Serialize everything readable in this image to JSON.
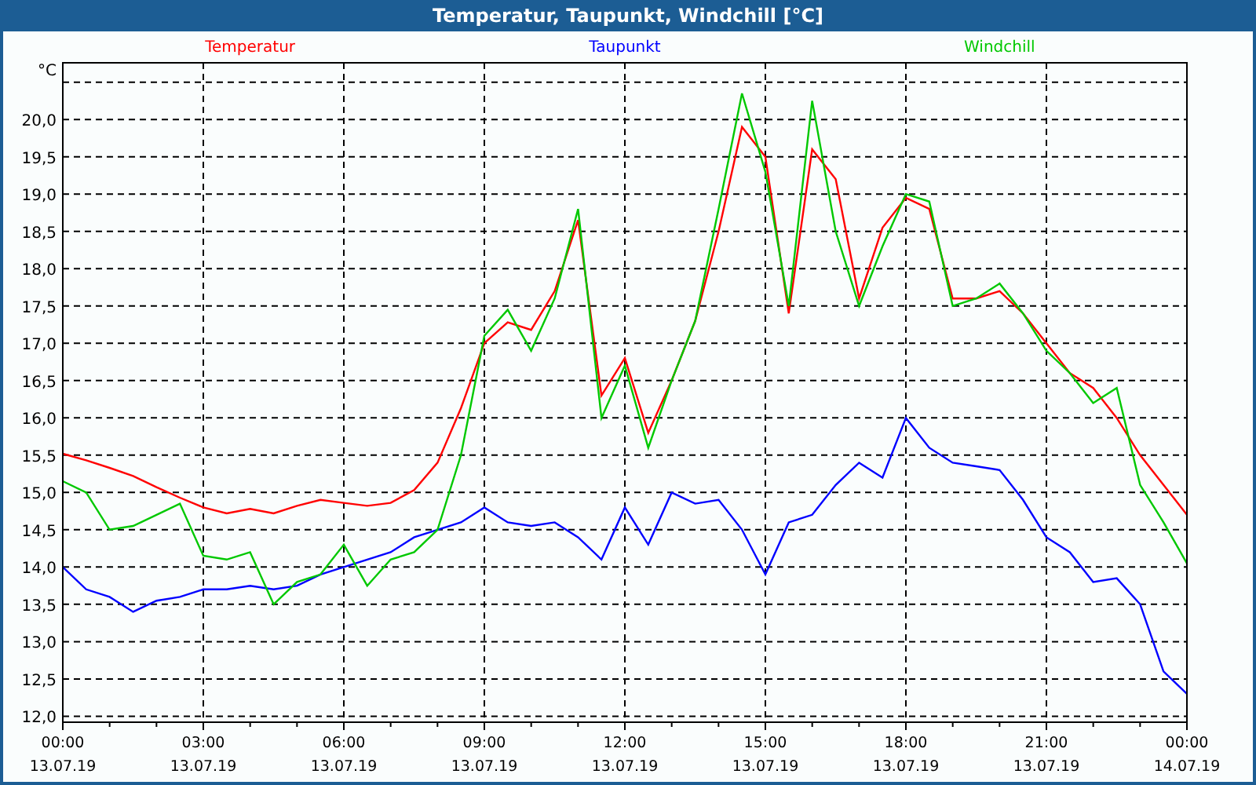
{
  "window": {
    "title": "Temperatur, Taupunkt, Windchill [°C]"
  },
  "chart": {
    "chart_data": {
      "type": "line",
      "grid": true,
      "ylabel": "°C",
      "categories": [
        "00:00\n13.07.19",
        null,
        null,
        null,
        null,
        null,
        "03:00\n13.07.19",
        null,
        null,
        null,
        null,
        null,
        "06:00\n13.07.19",
        null,
        null,
        null,
        null,
        null,
        "09:00\n13.07.19",
        null,
        null,
        null,
        null,
        null,
        "12:00\n13.07.19",
        null,
        null,
        null,
        null,
        null,
        "15:00\n13.07.19",
        null,
        null,
        null,
        null,
        null,
        "18:00\n13.07.19",
        null,
        null,
        null,
        null,
        null,
        "21:00\n13.07.19",
        null,
        null,
        null,
        null,
        null,
        "00:00\n14.07.19"
      ],
      "series": [
        {
          "name": "Temperatur",
          "color": "#ff0000",
          "values": [
            15.52,
            15.43,
            15.33,
            15.22,
            15.07,
            14.93,
            14.8,
            14.72,
            14.78,
            14.72,
            14.82,
            14.9,
            14.86,
            14.82,
            14.86,
            15.03,
            15.4,
            16.13,
            17.0,
            17.28,
            17.18,
            17.7,
            18.65,
            16.3,
            16.8,
            15.8,
            16.5,
            17.3,
            18.5,
            19.9,
            19.5,
            17.4,
            19.6,
            19.2,
            17.6,
            18.55,
            18.95,
            18.8,
            17.6,
            17.6,
            17.7,
            17.4,
            17.0,
            16.6,
            16.4,
            16.0,
            15.5,
            15.1,
            14.7
          ]
        },
        {
          "name": "Taupunkt",
          "color": "#0000ff",
          "values": [
            14.0,
            13.7,
            13.6,
            13.4,
            13.55,
            13.6,
            13.7,
            13.7,
            13.75,
            13.7,
            13.75,
            13.9,
            14.0,
            14.1,
            14.2,
            14.4,
            14.5,
            14.6,
            14.8,
            14.6,
            14.55,
            14.6,
            14.4,
            14.1,
            14.8,
            14.3,
            15.0,
            14.85,
            14.9,
            14.5,
            13.9,
            14.6,
            14.7,
            15.1,
            15.4,
            15.2,
            16.0,
            15.6,
            15.4,
            15.35,
            15.3,
            14.9,
            14.4,
            14.2,
            13.8,
            13.85,
            13.5,
            12.6,
            12.3
          ]
        },
        {
          "name": "Windchill",
          "color": "#00c800",
          "values": [
            15.15,
            15.0,
            14.5,
            14.55,
            14.7,
            14.85,
            14.15,
            14.1,
            14.2,
            13.5,
            13.8,
            13.9,
            14.3,
            13.75,
            14.1,
            14.2,
            14.5,
            15.5,
            17.1,
            17.45,
            16.9,
            17.6,
            18.8,
            16.0,
            16.7,
            15.6,
            16.5,
            17.3,
            18.8,
            20.35,
            19.3,
            17.5,
            20.25,
            18.5,
            17.5,
            18.3,
            19.0,
            18.9,
            17.5,
            17.6,
            17.8,
            17.4,
            16.9,
            16.6,
            16.2,
            16.4,
            15.1,
            14.6,
            14.05
          ]
        }
      ],
      "ylim": [
        11.92,
        20.76
      ],
      "yticks": [
        {
          "value": 12,
          "label": "12,0"
        },
        {
          "value": 12.5,
          "label": "12,5"
        },
        {
          "value": 13,
          "label": "13,0"
        },
        {
          "value": 13.5,
          "label": "13,5"
        },
        {
          "value": 14,
          "label": "14,0"
        },
        {
          "value": 14.5,
          "label": "14,5"
        },
        {
          "value": 15,
          "label": "15,0"
        },
        {
          "value": 15.5,
          "label": "15,5"
        },
        {
          "value": 16,
          "label": "16,0"
        },
        {
          "value": 16.5,
          "label": "16,5"
        },
        {
          "value": 17,
          "label": "17,0"
        },
        {
          "value": 17.5,
          "label": "17,5"
        },
        {
          "value": 18,
          "label": "18,0"
        },
        {
          "value": 18.5,
          "label": "18,5"
        },
        {
          "value": 19,
          "label": "19,0"
        },
        {
          "value": 19.5,
          "label": "19,5"
        },
        {
          "value": 20,
          "label": "20,0"
        }
      ]
    }
  }
}
